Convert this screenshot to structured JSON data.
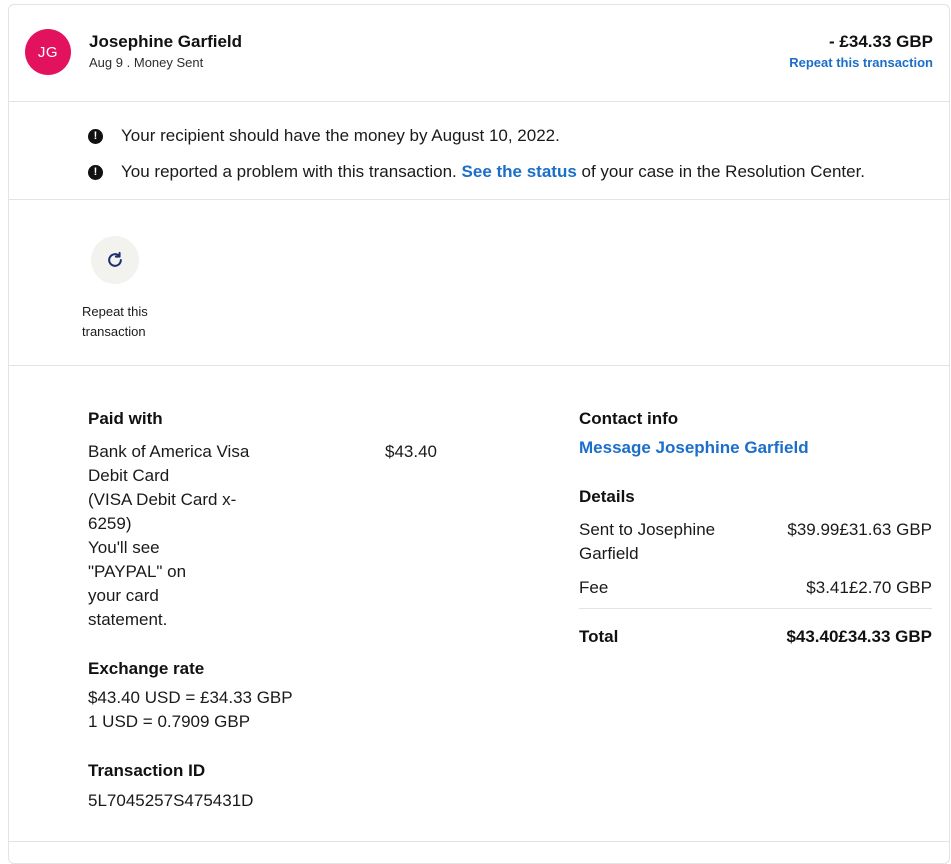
{
  "header": {
    "initials": "JG",
    "name": "Josephine Garfield",
    "date": "Aug 9",
    "separator": ".",
    "type": "Money Sent",
    "amount": "- £34.33 GBP",
    "repeat_link": "Repeat this transaction"
  },
  "notices": {
    "first": "Your recipient should have the money by August 10, 2022.",
    "second_before": "You reported a problem with this transaction.",
    "second_link": "See the status",
    "second_after": "of your case in the Resolution Center."
  },
  "actions": {
    "repeat_label": "Repeat this transaction"
  },
  "paid_with": {
    "heading": "Paid with",
    "source_lines": [
      "Bank of America Visa",
      "Debit Card",
      "(VISA Debit Card x-",
      "6259)",
      "You'll see",
      "\"PAYPAL\" on",
      "your card",
      "statement."
    ],
    "amount": "$43.40"
  },
  "exchange": {
    "heading": "Exchange rate",
    "line1": "$43.40 USD = £34.33 GBP",
    "line2": "1 USD = 0.7909 GBP"
  },
  "transaction": {
    "heading": "Transaction ID",
    "id": "5L7045257S475431D"
  },
  "contact": {
    "heading": "Contact info",
    "message_link": "Message Josephine Garfield"
  },
  "details": {
    "heading": "Details",
    "sent_label_lines": [
      "Sent to Josephine",
      "Garfield"
    ],
    "sent_amount": "$39.99£31.63 GBP",
    "fee_label": "Fee",
    "fee_amount": "$3.41£2.70 GBP",
    "total_label": "Total",
    "total_amount": "$43.40£34.33 GBP"
  }
}
